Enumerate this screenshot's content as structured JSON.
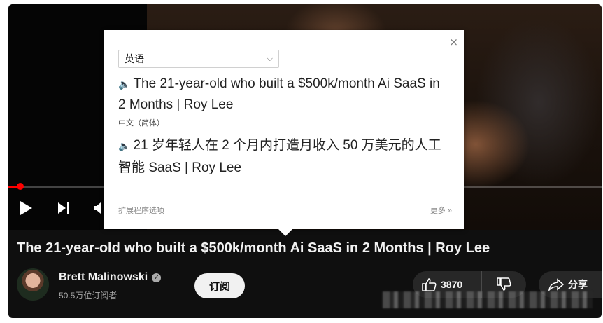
{
  "popup": {
    "language_select": "英语",
    "source_text": "The 21-year-old who built a $500k/month Ai SaaS in 2 Months | Roy Lee",
    "target_label": "中文（简体）",
    "target_text": "21 岁年轻人在 2 个月内打造月收入 50 万美元的人工智能 SaaS | Roy Lee",
    "extension_options": "扩展程序选项",
    "more": "更多 »",
    "close": "×"
  },
  "video": {
    "progress_fraction": 0.02
  },
  "title": "The 21-year-old who built a $500k/month Ai SaaS in 2 Months | Roy Lee",
  "channel": {
    "name": "Brett Malinowski",
    "subscribers": "50.5万位订阅者",
    "subscribe_label": "订阅"
  },
  "actions": {
    "like_count": "3870",
    "share_label": "分享"
  },
  "colors": {
    "background": "#0f0f0f",
    "progress": "#ff0000",
    "button_bg": "#272727"
  }
}
